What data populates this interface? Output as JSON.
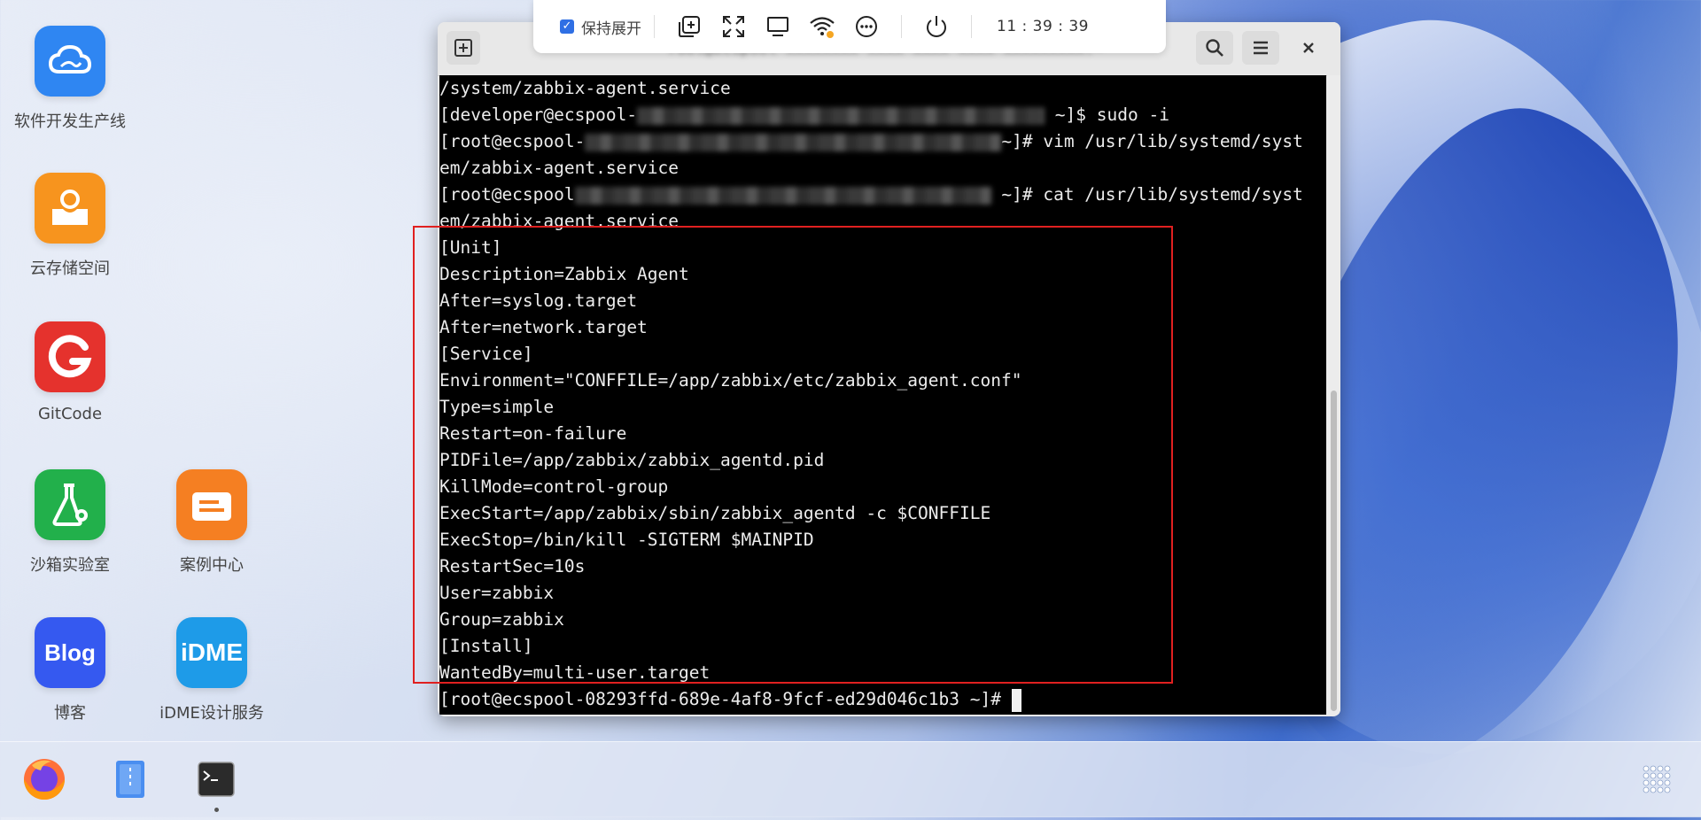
{
  "desktop": {
    "icons": [
      {
        "label": "软件开发生产线",
        "color": "#2f86f2"
      },
      {
        "label": "云存储空间",
        "color": "#f7941e"
      },
      {
        "label": "GitCode",
        "color": "#e5322d"
      },
      {
        "label": "沙箱实验室",
        "color": "#22b04b"
      },
      {
        "label": "案例中心",
        "color": "#f57f22"
      },
      {
        "label": "博客",
        "color": "#3559f0"
      },
      {
        "label": "iDME设计服务",
        "color": "#1e9be8"
      }
    ]
  },
  "toolbar": {
    "keep_expanded_label": "保持展开",
    "keep_expanded_checked": true,
    "time": "11 : 39 : 39",
    "icons": [
      "add-window-icon",
      "fullscreen-icon",
      "monitor-icon",
      "wifi-icon",
      "more-icon",
      "power-icon"
    ]
  },
  "terminal": {
    "lines": [
      {
        "text": "/system/zabbix-agent.service"
      },
      {
        "prefix": "[developer@ecspool-",
        "suffix": " ~]$ sudo -i",
        "blur": true
      },
      {
        "prefix": "[root@ecspool-",
        "suffix": "~]# vim /usr/lib/systemd/syst",
        "blur": true
      },
      {
        "text": "em/zabbix-agent.service"
      },
      {
        "prefix": "[root@ecspool",
        "suffix": " ~]# cat /usr/lib/systemd/syst",
        "blur": true
      },
      {
        "text": "em/zabbix-agent.service"
      },
      {
        "text": "[Unit]"
      },
      {
        "text": "Description=Zabbix Agent"
      },
      {
        "text": "After=syslog.target"
      },
      {
        "text": "After=network.target"
      },
      {
        "text": "[Service]"
      },
      {
        "text": "Environment=\"CONFFILE=/app/zabbix/etc/zabbix_agent.conf\""
      },
      {
        "text": "Type=simple"
      },
      {
        "text": "Restart=on-failure"
      },
      {
        "text": "PIDFile=/app/zabbix/zabbix_agentd.pid"
      },
      {
        "text": "KillMode=control-group"
      },
      {
        "text": "ExecStart=/app/zabbix/sbin/zabbix_agentd -c $CONFFILE"
      },
      {
        "text": "ExecStop=/bin/kill -SIGTERM $MAINPID"
      },
      {
        "text": "RestartSec=10s"
      },
      {
        "text": "User=zabbix"
      },
      {
        "text": "Group=zabbix"
      },
      {
        "text": "[Install]"
      },
      {
        "text": "WantedBy=multi-user.target"
      },
      {
        "text": "[root@ecspool-08293ffd-689e-4af8-9fcf-ed29d046c1b3 ~]# ",
        "cursor": true
      }
    ]
  },
  "taskbar": {
    "items": [
      "firefox-icon",
      "file-manager-icon",
      "terminal-icon"
    ],
    "app_grid": "app-grid-icon"
  }
}
